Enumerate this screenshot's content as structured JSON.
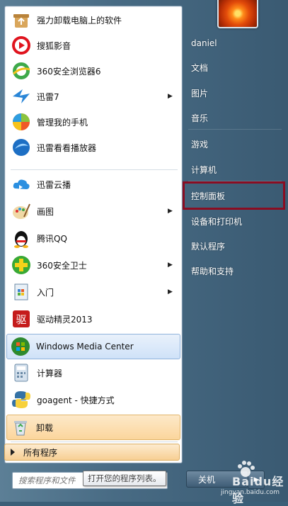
{
  "left_panel": {
    "items": [
      {
        "label": "强力卸载电脑上的软件",
        "icon": "uninstall-box-icon",
        "arrow": false
      },
      {
        "label": "搜狐影音",
        "icon": "sohu-player-icon",
        "arrow": false
      },
      {
        "label": "360安全浏览器6",
        "icon": "360-browser-icon",
        "arrow": false
      },
      {
        "label": "迅雷7",
        "icon": "xunlei-bird-icon",
        "arrow": true
      },
      {
        "label": "管理我的手机",
        "icon": "phone-manager-icon",
        "arrow": false
      },
      {
        "label": "迅雷看看播放器",
        "icon": "xunlei-player-icon",
        "arrow": false
      },
      {
        "label": "迅雷云播",
        "icon": "xunlei-cloud-icon",
        "arrow": false
      },
      {
        "label": "画图",
        "icon": "paint-icon",
        "arrow": true
      },
      {
        "label": "腾讯QQ",
        "icon": "qq-penguin-icon",
        "arrow": false
      },
      {
        "label": "360安全卫士",
        "icon": "360-guard-icon",
        "arrow": true
      },
      {
        "label": "入门",
        "icon": "getting-started-icon",
        "arrow": true
      },
      {
        "label": "驱动精灵2013",
        "icon": "driver-genius-icon",
        "arrow": false
      },
      {
        "label": "Windows Media Center",
        "icon": "windows-media-center-icon",
        "arrow": false
      },
      {
        "label": "计算器",
        "icon": "calculator-icon",
        "arrow": false
      },
      {
        "label": "goagent - 快捷方式",
        "icon": "python-shortcut-icon",
        "arrow": false
      },
      {
        "label": "卸载",
        "icon": "recycle-bin-icon",
        "arrow": false
      }
    ],
    "all_programs": "所有程序",
    "search_placeholder": "搜索程序和文件",
    "tooltip": "打开您的程序列表。"
  },
  "right_panel": {
    "user": "daniel",
    "items": [
      "文档",
      "图片",
      "音乐",
      "游戏",
      "计算机",
      "控制面板",
      "设备和打印机",
      "默认程序",
      "帮助和支持"
    ],
    "shutdown_label": "关机"
  },
  "watermark": {
    "brand": "Baidu经验",
    "url": "jingyan.baidu.com"
  },
  "colors": {
    "highlight_box": "#8a0d22",
    "accent_orange": "#fbd59c",
    "accent_blue": "#cfe2f8"
  }
}
